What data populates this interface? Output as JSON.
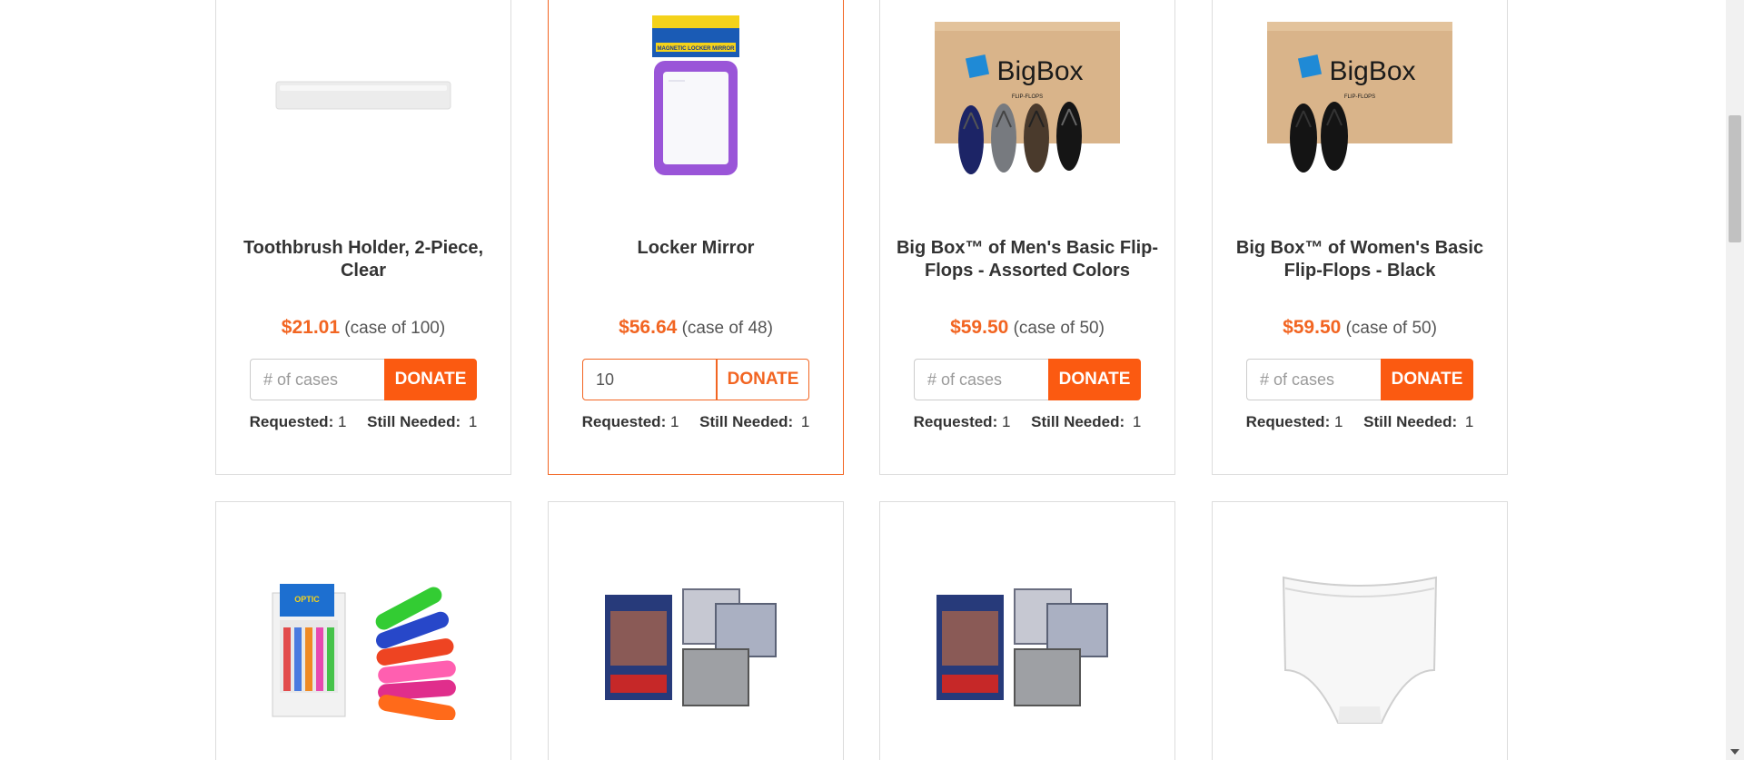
{
  "products": [
    {
      "title": "Toothbrush Holder, 2-Piece, Clear",
      "price": "$21.01",
      "case": "(case of 100)",
      "input_value": "",
      "placeholder": "# of cases",
      "donate_label": "DONATE",
      "requested_label": "Requested:",
      "requested": "1",
      "still_needed_label": "Still Needed:",
      "still_needed": "1",
      "icon": "toothbrush-holder-image"
    },
    {
      "title": "Locker Mirror",
      "price": "$56.64",
      "case": "(case of 48)",
      "input_value": "10",
      "placeholder": "# of cases",
      "donate_label": "DONATE",
      "requested_label": "Requested:",
      "requested": "1",
      "still_needed_label": "Still Needed:",
      "still_needed": "1",
      "icon": "locker-mirror-image",
      "package_text": "MAGNETIC LOCKER MIRROR"
    },
    {
      "title": "Big Box™ of Men's Basic Flip-Flops - Assorted Colors",
      "price": "$59.50",
      "case": "(case of 50)",
      "input_value": "",
      "placeholder": "# of cases",
      "donate_label": "DONATE",
      "requested_label": "Requested:",
      "requested": "1",
      "still_needed_label": "Still Needed:",
      "still_needed": "1",
      "icon": "big-box-flip-flops-image",
      "box_text": "BigBox",
      "box_sub": "FLIP-FLOPS"
    },
    {
      "title": "Big Box™ of Women's Basic Flip-Flops - Black",
      "price": "$59.50",
      "case": "(case of 50)",
      "input_value": "",
      "placeholder": "# of cases",
      "donate_label": "DONATE",
      "requested_label": "Requested:",
      "requested": "1",
      "still_needed_label": "Still Needed:",
      "still_needed": "1",
      "icon": "big-box-flip-flops-image",
      "box_text": "BigBox",
      "box_sub": "FLIP-FLOPS"
    }
  ],
  "row2": [
    {
      "icon": "nail-clipper-display-image",
      "package_text": "OPTIC"
    },
    {
      "icon": "boxer-shorts-image"
    },
    {
      "icon": "boxer-shorts-image"
    },
    {
      "icon": "white-briefs-image"
    }
  ],
  "colors": {
    "accent": "#fb5a11",
    "price": "#f26522",
    "border": "#dcdcdc"
  }
}
